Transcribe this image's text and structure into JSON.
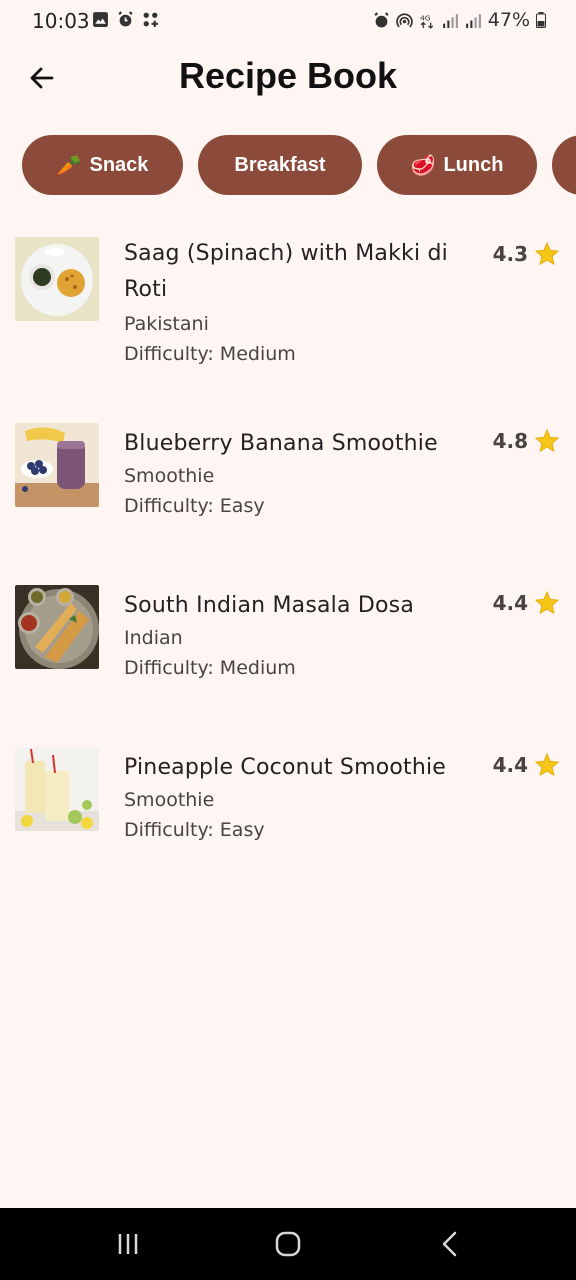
{
  "status_bar": {
    "time": "10:03",
    "battery": "47%"
  },
  "header": {
    "title": "Recipe Book",
    "back_icon": "arrow-left-icon"
  },
  "chips": [
    {
      "emoji": "🥕",
      "label": "Snack"
    },
    {
      "emoji": "",
      "label": "Breakfast"
    },
    {
      "emoji": "🥩",
      "label": "Lunch"
    }
  ],
  "recipes": [
    {
      "name_line1": "Saag (Spinach) with Makki di",
      "name_line2": "Roti",
      "cuisine": "Pakistani",
      "difficulty": "Difficulty: Medium",
      "rating": "4.3"
    },
    {
      "name_line1": "Blueberry Banana Smoothie",
      "name_line2": "",
      "cuisine": "Smoothie",
      "difficulty": "Difficulty: Easy",
      "rating": "4.8"
    },
    {
      "name_line1": "South Indian Masala Dosa",
      "name_line2": "",
      "cuisine": "Indian",
      "difficulty": "Difficulty: Medium",
      "rating": "4.4"
    },
    {
      "name_line1": "Pineapple Coconut Smoothie",
      "name_line2": "",
      "cuisine": "Smoothie",
      "difficulty": "Difficulty: Easy",
      "rating": "4.4"
    }
  ],
  "colors": {
    "background": "#fff6f4",
    "chip": "#8b4a3a",
    "star": "#f5c518"
  }
}
